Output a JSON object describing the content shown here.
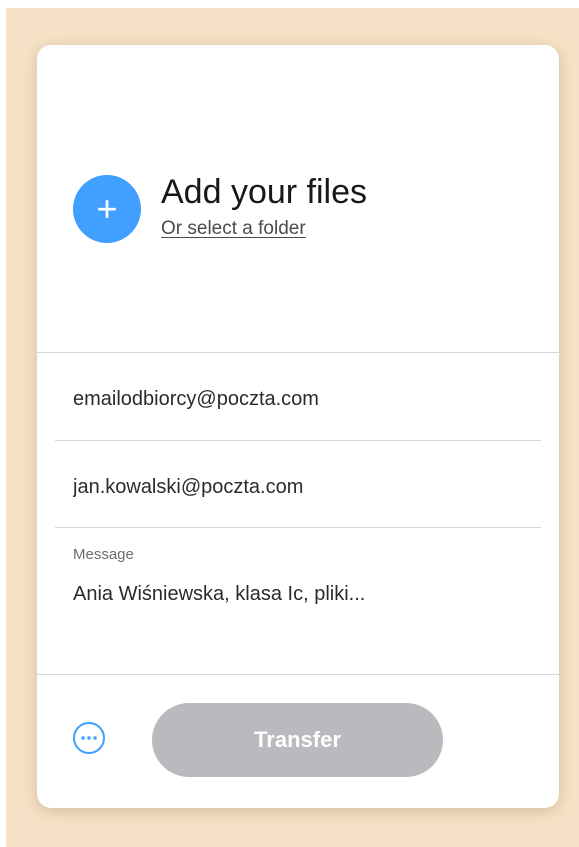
{
  "upload": {
    "add_icon": "plus-icon",
    "title": "Add your files",
    "select_folder": "Or select a folder"
  },
  "form": {
    "recipient_email": "emailodbiorcy@poczta.com",
    "sender_email": "jan.kowalski@poczta.com",
    "message_label": "Message",
    "message_value": "Ania Wiśniewska, klasa Ic, pliki..."
  },
  "footer": {
    "more_icon": "more-options-icon",
    "transfer_label": "Transfer"
  },
  "colors": {
    "accent": "#409fff",
    "button_disabled": "#b9babd",
    "backdrop": "#f5e2c6"
  }
}
